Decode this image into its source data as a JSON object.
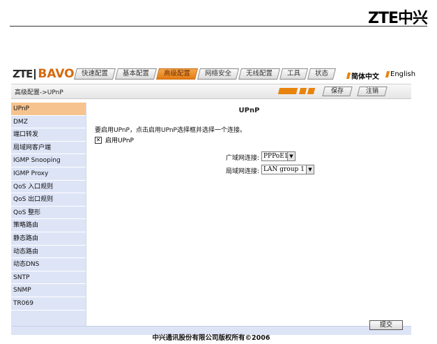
{
  "doc_header": {
    "logo": "ZTE中兴"
  },
  "brand": {
    "zte": "ZTE",
    "bavo": "BAVO"
  },
  "nav": {
    "tabs": [
      {
        "label": "快速配置",
        "active": false
      },
      {
        "label": "基本配置",
        "active": false
      },
      {
        "label": "高级配置",
        "active": true
      },
      {
        "label": "网络安全",
        "active": false
      },
      {
        "label": "无线配置",
        "active": false
      },
      {
        "label": "工具",
        "active": false
      },
      {
        "label": "状态",
        "active": false
      }
    ],
    "lang_zh": "简体中文",
    "lang_en": "English"
  },
  "subbar": {
    "breadcrumb": "高级配置->UPnP",
    "save_label": "保存",
    "logout_label": "注销"
  },
  "sidebar": {
    "items": [
      {
        "label": "UPnP",
        "active": true
      },
      {
        "label": "DMZ",
        "active": false
      },
      {
        "label": "端口转发",
        "active": false
      },
      {
        "label": "局域网客户端",
        "active": false
      },
      {
        "label": "IGMP Snooping",
        "active": false
      },
      {
        "label": "IGMP Proxy",
        "active": false
      },
      {
        "label": "QoS 入口规则",
        "active": false
      },
      {
        "label": "QoS 出口规则",
        "active": false
      },
      {
        "label": "QoS 整形",
        "active": false
      },
      {
        "label": "策略路由",
        "active": false
      },
      {
        "label": "静态路由",
        "active": false
      },
      {
        "label": "动态路由",
        "active": false
      },
      {
        "label": "动态DNS",
        "active": false
      },
      {
        "label": "SNTP",
        "active": false
      },
      {
        "label": "SNMP",
        "active": false
      },
      {
        "label": "TR069",
        "active": false
      }
    ]
  },
  "main": {
    "title": "UPnP",
    "hint": "要启用UPnP，点击启用UPnP选择框并选择一个连接。",
    "enable_label": "启用UPnP",
    "enable_checked": true,
    "wan_label": "广域网连接:",
    "wan_value": "PPPoE1",
    "lan_label": "局域网连接:",
    "lan_value": "LAN group 1",
    "submit_label": "提交"
  },
  "footer": {
    "copyright": "中兴通讯股份有限公司版权所有©2006"
  },
  "colors": {
    "accent_orange": "#e8830e",
    "sidebar_bg": "#dde4f6",
    "active_item": "#f6c38e"
  }
}
